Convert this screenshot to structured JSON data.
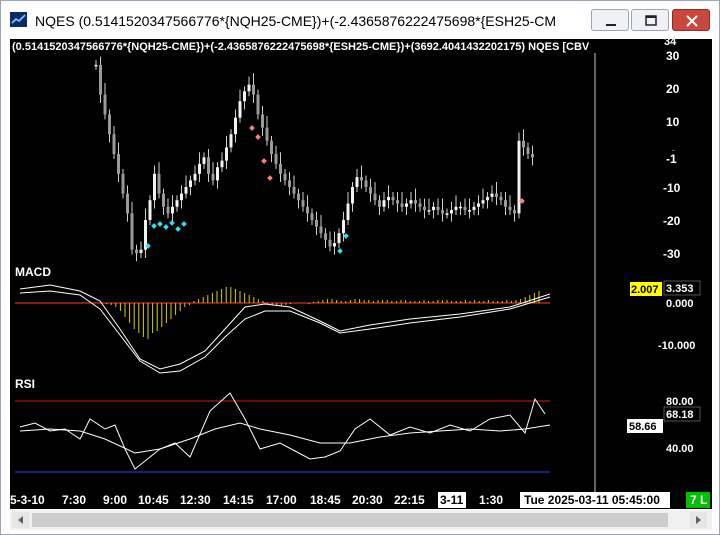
{
  "window": {
    "title": "NQES (0.5141520347566776*{NQH25-CME})+(-2.4365876222475698*{ESH25-CME})+(36",
    "minimize_label": "minimize",
    "maximize_label": "maximize",
    "close_label": "close"
  },
  "chart": {
    "symbol_header": "(0.5141520347566776*{NQH25-CME})+(-2.4365876222475698*{ESH25-CME})+(3692.4041432202175) NQES [CBV",
    "price_axis_ticks": [
      "30",
      "20",
      "10",
      "0",
      "-10",
      "-20",
      "-30"
    ],
    "price_top_partial": "34",
    "last_price_label": "-1",
    "macd_title": "MACD",
    "macd_axis_ticks": [
      "0.000",
      "-10.000"
    ],
    "macd_value_label": "3.353",
    "macd_highlight_label": "2.007",
    "rsi_title": "RSI",
    "rsi_axis_ticks": [
      "80.00",
      "40.00"
    ],
    "rsi_value_label": "68.18",
    "rsi_highlight_label": "58.66",
    "time_axis_labels": [
      "5-3-10",
      "7:30",
      "9:00",
      "10:45",
      "12:30",
      "14:15",
      "17:00",
      "18:45",
      "20:30",
      "22:15",
      "3-11",
      "1:30",
      "Tue 2025-03-11  05:45:00"
    ],
    "status_badge": "7 L",
    "colors": {
      "background": "#000000",
      "candles": "#e8e8e8",
      "macd_hist": "#d8d000",
      "macd_zero": "#ff3b1f",
      "rsi_upper": "#d01818",
      "rsi_lower": "#2244ff",
      "buy_marker": "#2fe0f0",
      "sell_marker": "#ff7a7a",
      "badge": "#00c000",
      "highlight": "#ffff00"
    },
    "rsi_levels": {
      "upper": 80,
      "lower": 30
    }
  }
}
